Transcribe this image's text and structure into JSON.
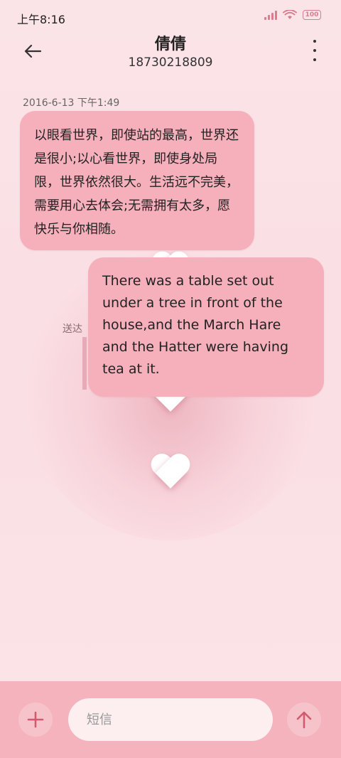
{
  "status_bar": {
    "time": "上午8:16",
    "battery": "100"
  },
  "header": {
    "contact_name": "倩倩",
    "contact_number": "18730218809"
  },
  "conversation": {
    "timestamp": "2016-6-13 下午1:49",
    "messages": [
      {
        "text": "以眼看世界，即使站的最高，世界还是很小;以心看世界，即使身处局限，世界依然很大。生活远不完美，需要用心去体会;无需拥有太多，愿快乐与你相随。"
      },
      {
        "text": "There was a table set out under a tree in front of the house,and the March Hare and the Hatter were having tea at it."
      }
    ],
    "faded_label": "送达"
  },
  "composer": {
    "placeholder": "短信",
    "add_icon": "plus-icon",
    "send_icon": "arrow-up-icon"
  },
  "colors": {
    "accent": "#d25a6e",
    "bubble": "#f5b0bb",
    "background": "#fbe4e8",
    "bottom_bar": "#f4b3bd"
  }
}
